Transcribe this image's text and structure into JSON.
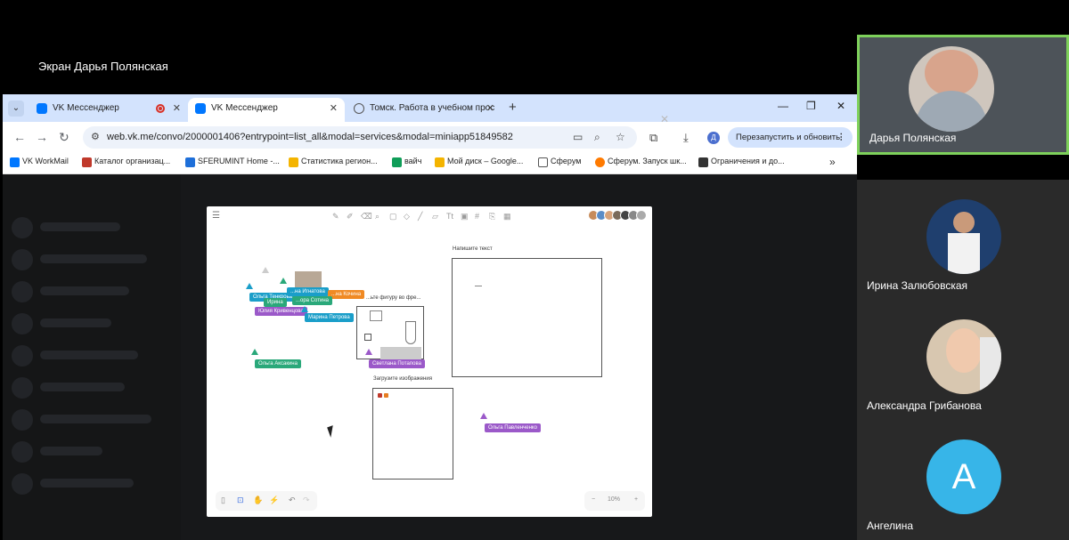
{
  "screen_share": {
    "title": "Экран Дарья Полянская"
  },
  "browser": {
    "tabs": [
      {
        "label": "VK Мессенджер",
        "close": "✕"
      },
      {
        "label": "VK Мессенджер",
        "close": "✕"
      },
      {
        "label": "Томск. Работа в учебном прос",
        "close": "✕"
      }
    ],
    "new_tab": "+",
    "url": "web.vk.me/convo/2000001406?entrypoint=list_all&modal=services&modal=miniapp51849582",
    "profile_letter": "Д",
    "relaunch_label": "Перезапустить и обновить",
    "bookmarks": [
      {
        "label": "VK WorkMail",
        "color": "#0077ff"
      },
      {
        "label": "Каталог организац...",
        "color": "#c0392b"
      },
      {
        "label": "SFERUMINT Home -...",
        "color": "#1e6fd9"
      },
      {
        "label": "Статистика регион...",
        "color": "#f4b400"
      },
      {
        "label": "вайч",
        "color": "#0f9d58"
      },
      {
        "label": "Мой диск – Google...",
        "color": "#f4b400"
      },
      {
        "label": "Сферум",
        "color": "#ffffff"
      },
      {
        "label": "Сферум. Запуск шк...",
        "color": "#ff7a00"
      },
      {
        "label": "Ограничения и до...",
        "color": "#333333"
      }
    ],
    "bookmarks_more": "»"
  },
  "whiteboard": {
    "frames": {
      "text_title": "Напишите текст",
      "shape_title": "...ьте фигуру во фре...",
      "upload_title": "Загрузите изображения"
    },
    "cursors": [
      {
        "name": "Ольга Тенкрова",
        "color": "#1a9ec9"
      },
      {
        "name": "Ирина",
        "color": "#2aa87a"
      },
      {
        "name": "...на Игнатова",
        "color": "#1a9ec9"
      },
      {
        "name": "...на Кочина",
        "color": "#f08a24"
      },
      {
        "name": "...ора Сотина",
        "color": "#2aa87a"
      },
      {
        "name": "Юлия Кривенцова",
        "color": "#9b59c9"
      },
      {
        "name": "Марина Петрова",
        "color": "#1a9ec9"
      },
      {
        "name": "Ольга Аксакина",
        "color": "#2aa87a"
      },
      {
        "name": "Светлана Потапова",
        "color": "#9b59c9"
      },
      {
        "name": "Ольга Павленченко",
        "color": "#9b59c9"
      }
    ],
    "zoom": "10%",
    "zoom_minus": "−",
    "zoom_plus": "+"
  },
  "participants": [
    {
      "name": "Дарья Полянская",
      "speaking": true
    },
    {
      "name": "Ирина Залюбовская",
      "speaking": false
    },
    {
      "name": "Александра Грибанова",
      "speaking": false
    },
    {
      "name": "Ангелина",
      "speaking": false,
      "initial": "A",
      "avatar_color": "#37b5e8"
    }
  ]
}
